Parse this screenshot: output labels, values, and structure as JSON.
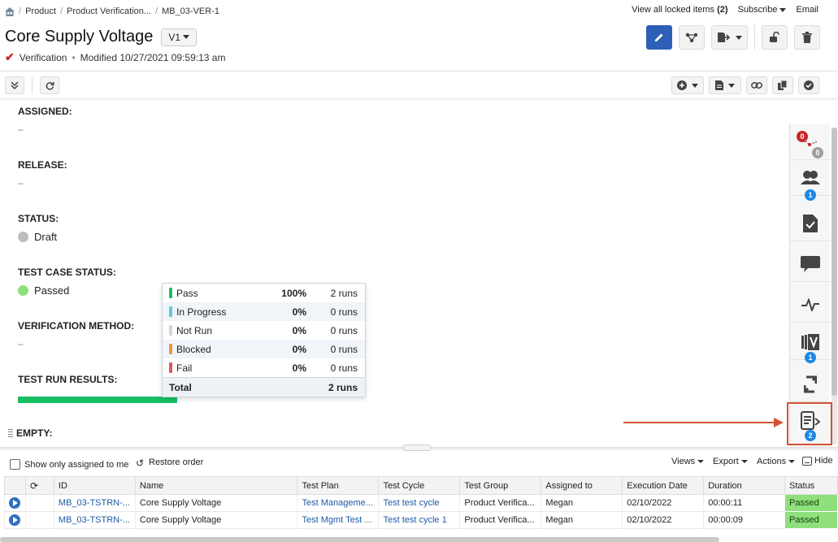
{
  "breadcrumb": [
    "Product",
    "Product Verification...",
    "MB_03-VER-1"
  ],
  "top_links": {
    "locked_prefix": "View all locked items",
    "locked_count": "(2)",
    "subscribe": "Subscribe",
    "email": "Email"
  },
  "header": {
    "title": "Core Supply Voltage",
    "version": "V1",
    "type": "Verification",
    "modified": "Modified 10/27/2021 09:59:13 am"
  },
  "fields": {
    "assigned_label": "ASSIGNED:",
    "assigned_value": "–",
    "release_label": "RELEASE:",
    "release_value": "–",
    "status_label": "STATUS:",
    "status_value": "Draft",
    "tcs_label": "TEST CASE STATUS:",
    "tcs_value": "Passed",
    "vm_label": "VERIFICATION METHOD:",
    "vm_value": "–",
    "trr_label": "TEST RUN RESULTS:",
    "trr_progress_pct": 100,
    "empty_label": "EMPTY:"
  },
  "popup": {
    "rows": [
      {
        "name": "Pass",
        "pct": "100%",
        "runs": "2 runs",
        "color": "#17bf63"
      },
      {
        "name": "In Progress",
        "pct": "0%",
        "runs": "0 runs",
        "color": "#5bc8e0"
      },
      {
        "name": "Not Run",
        "pct": "0%",
        "runs": "0 runs",
        "color": "#d6d6d6"
      },
      {
        "name": "Blocked",
        "pct": "0%",
        "runs": "0 runs",
        "color": "#f0963c"
      },
      {
        "name": "Fail",
        "pct": "0%",
        "runs": "0 runs",
        "color": "#e05a5a"
      }
    ],
    "total_label": "Total",
    "total_runs": "2 runs"
  },
  "sidebar": {
    "badges": {
      "trace_upstream": "0",
      "trace_downstream": "0",
      "users": "1",
      "versions": "1",
      "test_runs": "2"
    }
  },
  "bottom": {
    "show_only_assigned": "Show only assigned to me",
    "restore_order": "Restore order",
    "views": "Views",
    "export": "Export",
    "actions": "Actions",
    "hide": "Hide",
    "columns": [
      "",
      "",
      "ID",
      "Name",
      "Test Plan",
      "Test Cycle",
      "Test Group",
      "Assigned to",
      "Execution Date",
      "Duration",
      "Status"
    ],
    "rows": [
      {
        "id": "MB_03-TSTRN-...",
        "name": "Core Supply Voltage",
        "plan": "Test Manageme...",
        "cycle": "Test test cycle",
        "group": "Product Verifica...",
        "assigned": "Megan",
        "date": "02/10/2022",
        "duration": "00:00:11",
        "status": "Passed"
      },
      {
        "id": "MB_03-TSTRN-...",
        "name": "Core Supply Voltage",
        "plan": "Test Mgmt Test ...",
        "cycle": "Test test cycle 1",
        "group": "Product Verifica...",
        "assigned": "Megan",
        "date": "02/10/2022",
        "duration": "00:00:09",
        "status": "Passed"
      }
    ]
  },
  "colors": {
    "accent": "#2e5fb7",
    "highlight": "#d35432",
    "passed": "#8ee07c"
  }
}
